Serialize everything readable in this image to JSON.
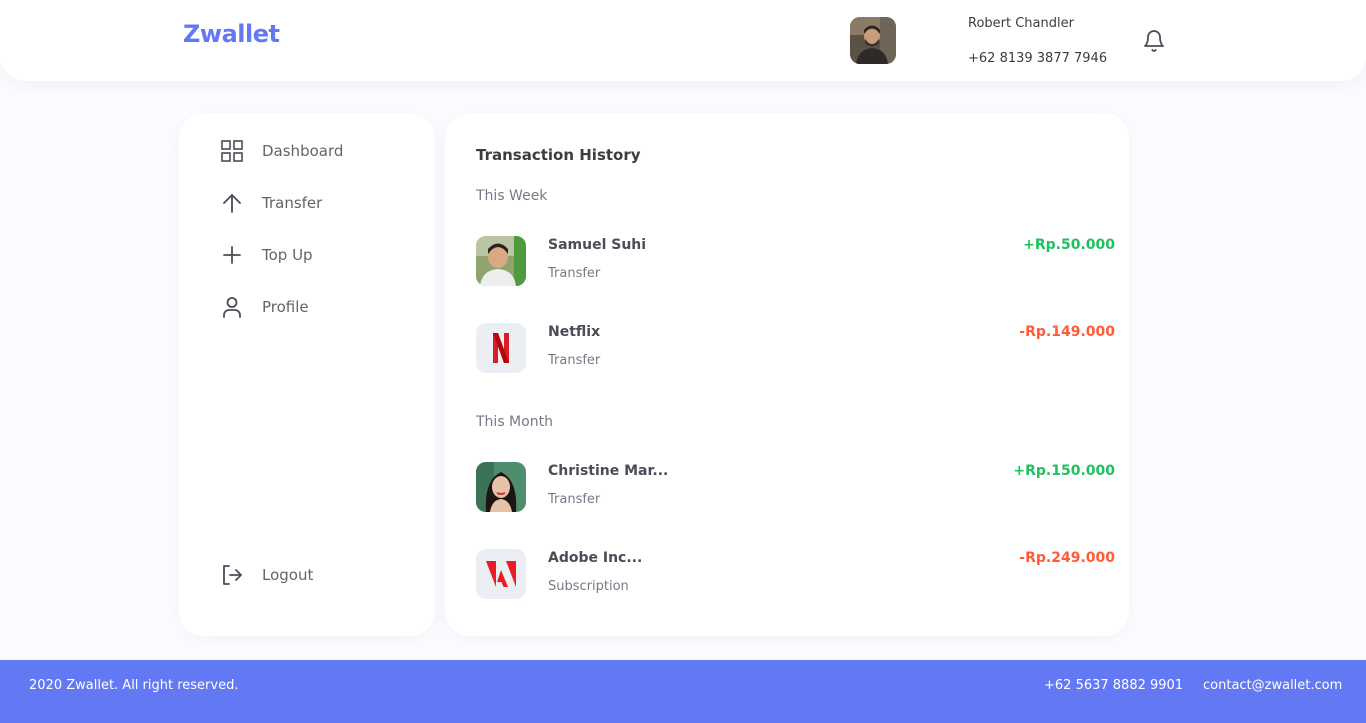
{
  "header": {
    "brand": "Zwallet",
    "user": {
      "name": "Robert Chandler",
      "phone": "+62 8139 3877 7946",
      "avatar_icon": "user-avatar-photo"
    },
    "notification_icon": "bell-icon"
  },
  "sidebar": {
    "items": [
      {
        "label": "Dashboard",
        "icon": "grid-icon"
      },
      {
        "label": "Transfer",
        "icon": "arrow-up-icon"
      },
      {
        "label": "Top Up",
        "icon": "plus-icon"
      },
      {
        "label": "Profile",
        "icon": "user-icon"
      }
    ],
    "logout": {
      "label": "Logout",
      "icon": "logout-icon"
    }
  },
  "main": {
    "title": "Transaction History",
    "sections": [
      {
        "label": "This Week",
        "transactions": [
          {
            "name": "Samuel Suhi",
            "type": "Transfer",
            "amount": "+Rp.50.000",
            "direction": "in",
            "thumb": "person-photo"
          },
          {
            "name": "Netflix",
            "type": "Transfer",
            "amount": "-Rp.149.000",
            "direction": "out",
            "thumb": "netflix-logo"
          }
        ]
      },
      {
        "label": "This Month",
        "transactions": [
          {
            "name": "Christine Mar...",
            "type": "Transfer",
            "amount": "+Rp.150.000",
            "direction": "in",
            "thumb": "person-photo"
          },
          {
            "name": "Adobe Inc...",
            "type": "Subscription",
            "amount": "-Rp.249.000",
            "direction": "out",
            "thumb": "adobe-logo"
          }
        ]
      }
    ]
  },
  "footer": {
    "copyright": "2020 Zwallet. All right reserved.",
    "phone": "+62 5637 8882 9901",
    "email": "contact@zwallet.com"
  },
  "colors": {
    "brand": "#6379F4",
    "positive": "#1EC15F",
    "negative": "#FF5B37",
    "text": "#3A3D42",
    "muted": "#7A7886"
  }
}
